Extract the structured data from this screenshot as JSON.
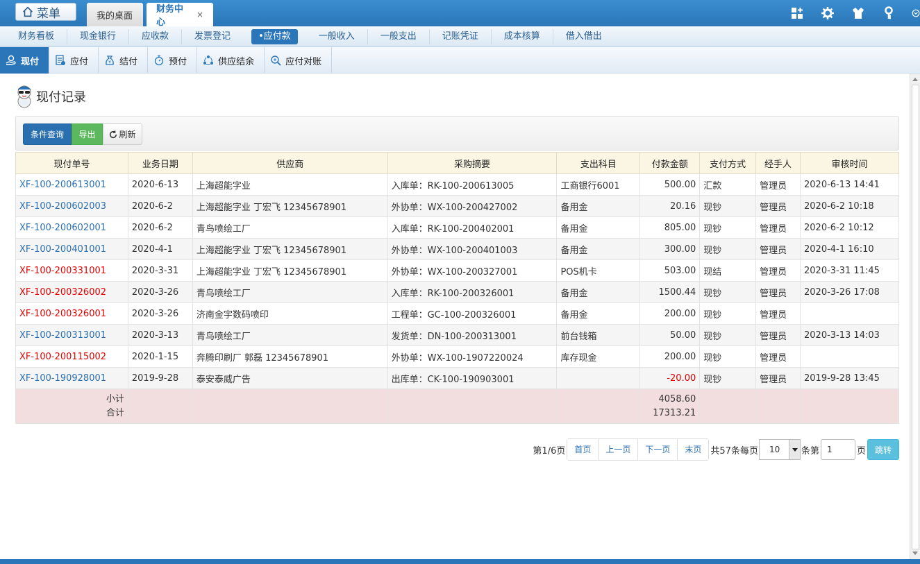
{
  "topbar": {
    "menu_label": "菜单",
    "tabs": [
      {
        "label": "我的桌面"
      },
      {
        "label": "财务中心",
        "close": "×"
      }
    ]
  },
  "modules": [
    {
      "label": "财务看板"
    },
    {
      "label": "现金银行"
    },
    {
      "label": "应收款"
    },
    {
      "label": "发票登记"
    },
    {
      "label": "•应付款",
      "active": true
    },
    {
      "label": "一般收入"
    },
    {
      "label": "一般支出"
    },
    {
      "label": "记账凭证"
    },
    {
      "label": "成本核算"
    },
    {
      "label": "借入借出"
    }
  ],
  "subtabs": [
    {
      "label": "现付",
      "active": true
    },
    {
      "label": "应付"
    },
    {
      "label": "结付"
    },
    {
      "label": "预付"
    },
    {
      "label": "供应结余"
    },
    {
      "label": "应付对账"
    }
  ],
  "page_title": "现付记录",
  "toolbar": {
    "query_label": "条件查询",
    "export_label": "导出",
    "refresh_label": "刷新"
  },
  "table": {
    "headers": [
      "现付单号",
      "业务日期",
      "供应商",
      "采购摘要",
      "支出科目",
      "付款金额",
      "支付方式",
      "经手人",
      "审核时间"
    ],
    "rows": [
      {
        "no": "XF-100-200613001",
        "date": "2020-6-13",
        "supplier": "上海超能字业",
        "summary": "入库单：RK-100-200613005",
        "account": "工商银行6001",
        "amount": "500.00",
        "method": "汇款",
        "handler": "管理员",
        "audit": "2020-6-13 14:41"
      },
      {
        "no": "XF-100-200602003",
        "date": "2020-6-2",
        "supplier": "上海超能字业 丁宏飞 12345678901",
        "summary": "外协单：WX-100-200427002",
        "account": "备用金",
        "amount": "20.16",
        "method": "现钞",
        "handler": "管理员",
        "audit": "2020-6-2 10:18"
      },
      {
        "no": "XF-100-200602001",
        "date": "2020-6-2",
        "supplier": "青鸟喷绘工厂",
        "summary": "入库单：RK-100-200402001",
        "account": "备用金",
        "amount": "805.00",
        "method": "现钞",
        "handler": "管理员",
        "audit": "2020-6-2 10:12"
      },
      {
        "no": "XF-100-200401001",
        "date": "2020-4-1",
        "supplier": "上海超能字业 丁宏飞 12345678901",
        "summary": "外协单：WX-100-200401003",
        "account": "备用金",
        "amount": "300.00",
        "method": "现钞",
        "handler": "管理员",
        "audit": "2020-4-1 16:10"
      },
      {
        "no": "XF-100-200331001",
        "date": "2020-3-31",
        "supplier": "上海超能字业 丁宏飞 12345678901",
        "summary": "外协单：WX-100-200327001",
        "account": "POS机卡",
        "amount": "503.00",
        "method": "现结",
        "handler": "管理员",
        "audit": "2020-3-31 11:45"
      },
      {
        "no": "XF-100-200326002",
        "date": "2020-3-26",
        "supplier": "青鸟喷绘工厂",
        "summary": "入库单：RK-100-200326001",
        "account": "备用金",
        "amount": "1500.44",
        "method": "现钞",
        "handler": "管理员",
        "audit": "2020-3-26 17:08"
      },
      {
        "no": "XF-100-200326001",
        "date": "2020-3-26",
        "supplier": "济南金宇数码喷印",
        "summary": "工程单：GC-100-200326001",
        "account": "备用金",
        "amount": "200.00",
        "method": "现钞",
        "handler": "管理员",
        "audit": ""
      },
      {
        "no": "XF-100-200313001",
        "date": "2020-3-13",
        "supplier": "青鸟喷绘工厂",
        "summary": "发货单：DN-100-200313001",
        "account": "前台钱箱",
        "amount": "50.00",
        "method": "现钞",
        "handler": "管理员",
        "audit": "2020-3-13 14:03"
      },
      {
        "no": "XF-100-200115002",
        "date": "2020-1-15",
        "supplier": "奔腾印刷厂 郭磊 12345678901",
        "summary": "外协单：WX-100-1907220024",
        "account": "库存现金",
        "amount": "200.00",
        "method": "现钞",
        "handler": "管理员",
        "audit": ""
      },
      {
        "no": "XF-100-190928001",
        "date": "2019-9-28",
        "supplier": "泰安泰威广告",
        "summary": "出库单：CK-100-190903001",
        "account": "",
        "amount": "-20.00",
        "method": "现钞",
        "handler": "管理员",
        "audit": "2019-9-28 13:45"
      }
    ],
    "subtotal_label": "小计",
    "total_label": "合计",
    "subtotal": "4058.60",
    "total": "17313.21",
    "colors": {
      "link_blue": "#2a6fb0",
      "link_red": "#e00000"
    }
  },
  "pager": {
    "page_info": "第1/6页",
    "first": "首页",
    "prev": "上一页",
    "next": "下一页",
    "last": "末页",
    "total_text": "共57条每页",
    "per_page": "10",
    "unit_text": "条第",
    "page_input": "1",
    "page_suffix": "页",
    "go": "跳转"
  }
}
